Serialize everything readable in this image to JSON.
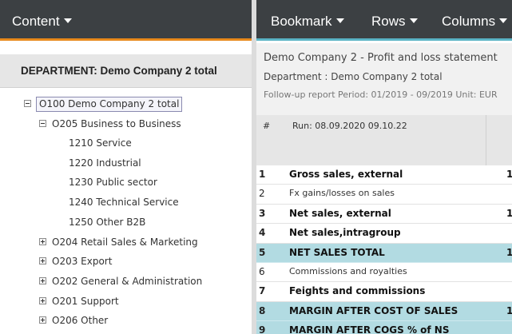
{
  "left_toolbar": {
    "content_label": "Content"
  },
  "right_toolbar": {
    "bookmark_label": "Bookmark",
    "rows_label": "Rows",
    "columns_label": "Columns"
  },
  "department_header": "DEPARTMENT: Demo Company 2 total",
  "tree": [
    {
      "label": "O100 Demo Company 2 total",
      "toggle": "minus",
      "selected": true
    },
    {
      "label": "O205 Business to Business",
      "toggle": "minus"
    },
    {
      "label": "1210 Service"
    },
    {
      "label": "1220 Industrial"
    },
    {
      "label": "1230 Public sector"
    },
    {
      "label": "1240 Technical Service"
    },
    {
      "label": "1250 Other B2B"
    },
    {
      "label": "O204 Retail Sales & Marketing",
      "toggle": "plus"
    },
    {
      "label": "O203 Export",
      "toggle": "plus"
    },
    {
      "label": "O202 General & Administration",
      "toggle": "plus"
    },
    {
      "label": "O201 Support",
      "toggle": "plus"
    },
    {
      "label": "O206 Other",
      "toggle": "plus"
    }
  ],
  "report": {
    "title": "Demo Company 2 - Profit and loss statement",
    "department": "Department : Demo Company 2 total",
    "info": "Follow-up report Period: 01/2019 - 09/2019 Unit: EUR",
    "col_hash": "#",
    "col_run": "Run: 08.09.2020 09.10.22",
    "rows": [
      {
        "num": "1",
        "label": "Gross sales, external",
        "bold": true,
        "highlight": false,
        "value": "1"
      },
      {
        "num": "2",
        "label": "Fx gains/losses on sales",
        "bold": false,
        "highlight": false,
        "value": ""
      },
      {
        "num": "3",
        "label": "Net sales, external",
        "bold": true,
        "highlight": false,
        "value": "1"
      },
      {
        "num": "4",
        "label": "Net sales,intragroup",
        "bold": true,
        "highlight": false,
        "value": ""
      },
      {
        "num": "5",
        "label": "NET SALES TOTAL",
        "bold": true,
        "highlight": true,
        "value": "1"
      },
      {
        "num": "6",
        "label": "Commissions and royalties",
        "bold": false,
        "highlight": false,
        "value": ""
      },
      {
        "num": "7",
        "label": "Feights and commissions",
        "bold": true,
        "highlight": false,
        "value": ""
      },
      {
        "num": "8",
        "label": "MARGIN AFTER COST OF SALES",
        "bold": true,
        "highlight": true,
        "value": "1"
      },
      {
        "num": "9",
        "label": "MARGIN AFTER COGS % of NS",
        "bold": true,
        "highlight": true,
        "value": ""
      }
    ]
  }
}
